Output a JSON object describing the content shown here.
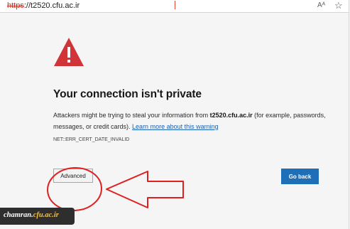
{
  "address_bar": {
    "scheme": "https",
    "rest_of_url": "://t2520.cfu.ac.ir",
    "read_aloud_icon": "read-aloud-icon",
    "read_aloud_glyph": "Aᴬ",
    "favorite_icon": "star-icon",
    "favorite_glyph": "☆"
  },
  "error_page": {
    "icon": "warning-triangle-icon",
    "headline": "Your connection isn't private",
    "explanation_part1": "Attackers might be trying to steal your information from ",
    "site": "t2520.cfu.ac.ir",
    "explanation_part2": " (for example, passwords, messages, or credit cards). ",
    "learn_more": "Learn more about this warning",
    "error_code": "NET::ERR_CERT_DATE_INVALID",
    "advanced_label": "Advanced",
    "go_back_label": "Go back"
  },
  "watermark": {
    "part1": "chamran.",
    "part2": "cfu.ac.ir"
  },
  "colors": {
    "not_secure_red": "#c42b1c",
    "triangle_red": "#d13438",
    "link_blue": "#1a5fb4",
    "button_blue": "#1f6fb8",
    "annotation_red": "#e02020"
  }
}
